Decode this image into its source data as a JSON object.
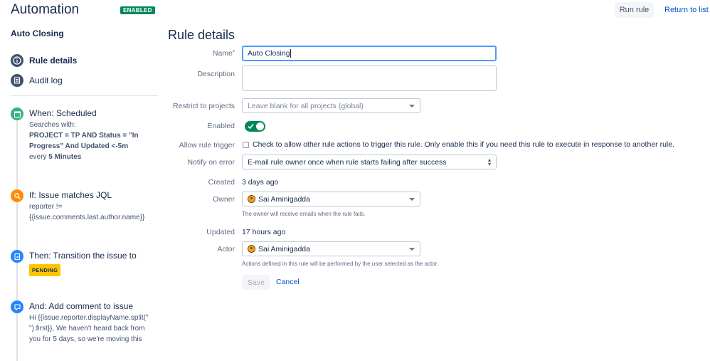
{
  "header": {
    "title": "Automation",
    "status_badge": "ENABLED",
    "run_rule": "Run rule",
    "return_to_list": "Return to list"
  },
  "sidebar": {
    "rule_name": "Auto Closing",
    "nav": [
      {
        "label": "Rule details",
        "icon": "info-icon",
        "active": true
      },
      {
        "label": "Audit log",
        "icon": "list-icon",
        "active": false
      }
    ],
    "steps": [
      {
        "icon": "calendar-icon",
        "color": "#36b37e",
        "title": "When: Scheduled",
        "line1": "Searches with:",
        "line2": "PROJECT = TP AND Status = \"In Progress\" And Updated <-5m",
        "line3_prefix": "every ",
        "line3_bold": "5 Minutes"
      },
      {
        "icon": "search-icon",
        "color": "#ff8b00",
        "title": "If: Issue matches JQL",
        "body": "reporter != {{issue.comments.last.author.name}}"
      },
      {
        "icon": "transition-icon",
        "color": "#2684ff",
        "title": "Then: Transition the issue to",
        "badge": "PENDING"
      },
      {
        "icon": "comment-icon",
        "color": "#2684ff",
        "title": "And: Add comment to issue",
        "body": "Hi {{issue.reporter.displayName.split(\" \").first}}, We haven't heard back from you for 5 days, so we're moving this"
      }
    ]
  },
  "form": {
    "title": "Rule details",
    "name_label": "Name",
    "name_value": "Auto Closing",
    "description_label": "Description",
    "description_value": "",
    "restrict_label": "Restrict to projects",
    "restrict_placeholder": "Leave blank for all projects (global)",
    "enabled_label": "Enabled",
    "enabled": true,
    "allow_trigger_label": "Allow rule trigger",
    "allow_trigger_text": "Check to allow other rule actions to trigger this rule. Only enable this if you need this rule to execute in response to another rule.",
    "notify_label": "Notify on error",
    "notify_value": "E-mail rule owner once when rule starts failing after success",
    "created_label": "Created",
    "created_value": "3 days ago",
    "owner_label": "Owner",
    "owner_value": "Sai Aminigadda",
    "owner_help": "The owner will receive emails when the rule fails.",
    "updated_label": "Updated",
    "updated_value": "17 hours ago",
    "actor_label": "Actor",
    "actor_value": "Sai Aminigadda",
    "actor_help": "Actions defined in this rule will be performed by the user selected as the actor.",
    "save_label": "Save",
    "cancel_label": "Cancel"
  }
}
